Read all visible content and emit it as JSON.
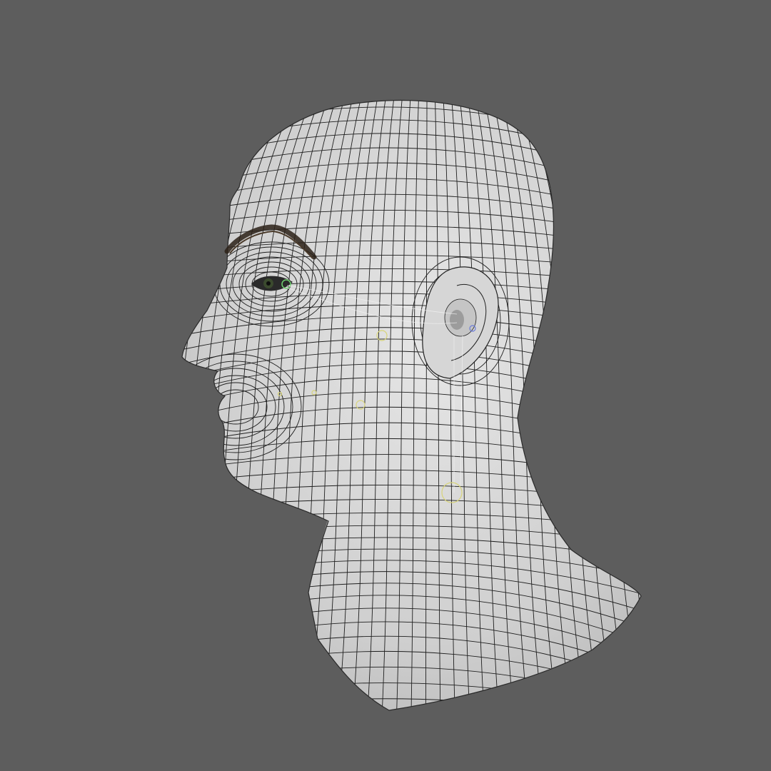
{
  "viewport": {
    "background_color": "#5d5d5d",
    "surface_color": "#dcdcdc",
    "wire_color": "#1e1e1e",
    "helper_color_yellow": "#d8d47a",
    "helper_color_green": "#6fd16f",
    "helper_color_blue": "#6a7bd8"
  },
  "model": {
    "subject": "head-and-neck",
    "display_mode": "wireframe-on-shaded"
  }
}
